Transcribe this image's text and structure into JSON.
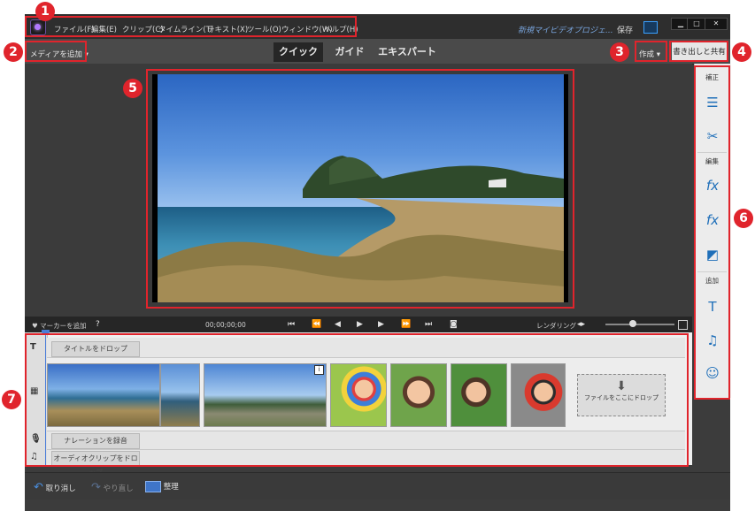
{
  "menu": {
    "items": [
      "ファイル(F)",
      "編集(E)",
      "クリップ(C)",
      "タイムライン(T)",
      "テキスト(X)",
      "ツール(O)",
      "ウィンドウ(W)",
      "ヘルプ(H)"
    ],
    "project_title": "新規マイビデオプロジェ...",
    "save_label": "保存"
  },
  "modebar": {
    "add_media": "メディアを追加",
    "tabs": [
      "クイック",
      "ガイド",
      "エキスパート"
    ],
    "active_tab": "クイック",
    "create": "作成",
    "share": "書き出しと共有"
  },
  "controls": {
    "marker": "マーカーを追加",
    "timecode": "00;00;00;00",
    "render": "レンダリング"
  },
  "right_panel": {
    "sections": [
      "補正",
      "編集",
      "追加"
    ]
  },
  "timeline": {
    "title_drop": "タイトルをドロップ",
    "file_drop": "ファイルをここにドロップ",
    "narration": "ナレーションを録音",
    "audio_drop": "オーディオクリップをドロップ"
  },
  "bottom": {
    "undo": "取り消し",
    "redo": "やり直し",
    "organize": "整理"
  },
  "annotations": [
    "1",
    "2",
    "3",
    "4",
    "5",
    "6",
    "7"
  ],
  "colors": {
    "annotation": "#e0242c",
    "accent": "#1f6fb9"
  }
}
